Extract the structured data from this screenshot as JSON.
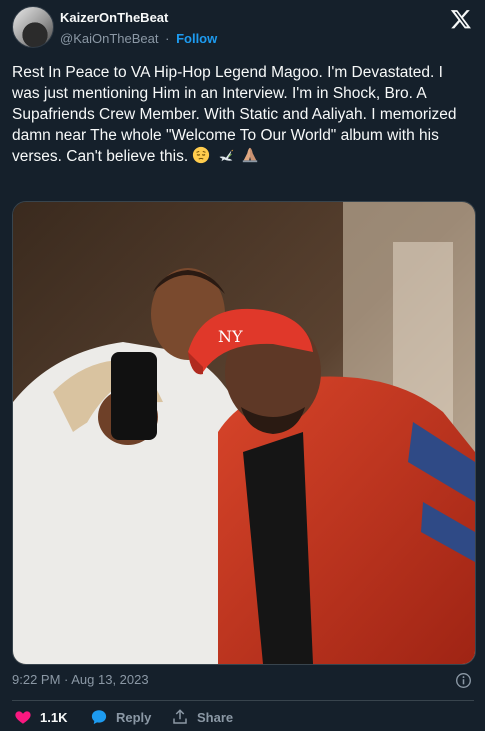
{
  "author": {
    "name": "KaizerOnTheBeat",
    "handle": "@KaiOnTheBeat",
    "separator": "·",
    "follow_label": "Follow"
  },
  "tweet": {
    "text": "Rest In Peace to VA Hip-Hop Legend Magoo. I'm Devastated. I was just mentioning Him in an Interview. I'm in Shock, Bro. A Supafriends Crew Member. With Static and Aaliyah.  I memorized damn near The whole \"Welcome To Our World\" album with his verses. Can't believe this.",
    "emojis": [
      "pensive-face-icon",
      "dove-icon",
      "folded-hands-icon"
    ],
    "timestamp": "9:22 PM · Aug 13, 2023"
  },
  "media": {
    "icon": "photo-of-two-men-taking-selfie"
  },
  "actions": {
    "like_count": "1.1K",
    "reply_label": "Reply",
    "share_label": "Share"
  },
  "colors": {
    "background": "#15202b",
    "text": "#f7f9f9",
    "muted": "#8b98a5",
    "accent": "#1d9bf0",
    "like": "#f91880",
    "divider": "#38444d"
  }
}
